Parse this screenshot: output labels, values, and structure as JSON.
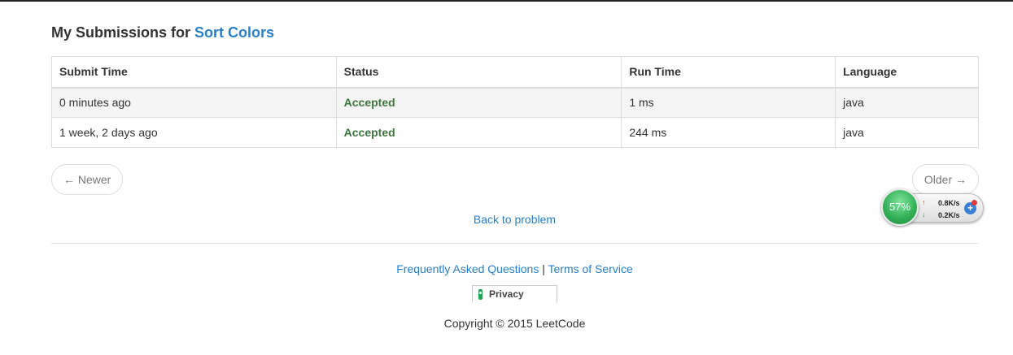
{
  "header": {
    "prefix": "My Submissions for",
    "problem_link": "Sort Colors"
  },
  "table": {
    "columns": [
      "Submit Time",
      "Status",
      "Run Time",
      "Language"
    ],
    "rows": [
      {
        "submit_time": "0 minutes ago",
        "status": "Accepted",
        "run_time": "1 ms",
        "language": "java"
      },
      {
        "submit_time": "1 week, 2 days ago",
        "status": "Accepted",
        "run_time": "244 ms",
        "language": "java"
      }
    ]
  },
  "pager": {
    "newer": "← Newer",
    "older": "Older →"
  },
  "back_link": "Back to problem",
  "footer": {
    "faq": "Frequently Asked Questions",
    "separator": "|",
    "terms": "Terms of Service",
    "privacy": "Privacy",
    "copyright": "Copyright © 2015 LeetCode"
  },
  "net_widget": {
    "percent": "57%",
    "upload": "0.8K/s",
    "download": "0.2K/s"
  },
  "colors": {
    "link": "#2a7fc4",
    "accepted": "#3c763d",
    "widget_green": "#2fae55"
  },
  "icons": [
    "lock-icon",
    "upload-arrow-icon",
    "download-arrow-icon",
    "plus-icon"
  ]
}
